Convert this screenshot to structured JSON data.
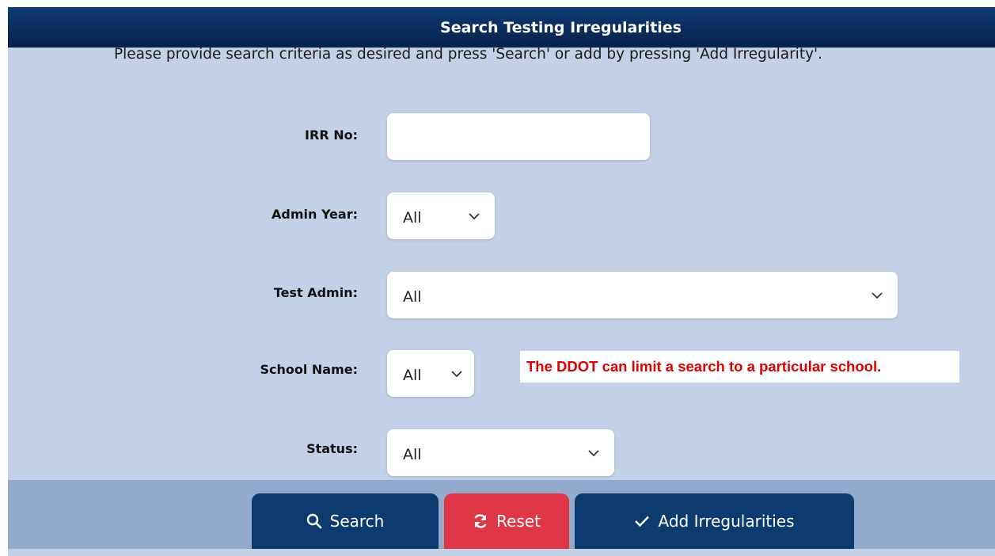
{
  "header": {
    "title": "Search Testing Irregularities"
  },
  "instructions": "Please provide search criteria as desired and press 'Search' or add by pressing 'Add Irregularity'.",
  "form": {
    "irr_no": {
      "label": "IRR No:",
      "value": ""
    },
    "admin_year": {
      "label": "Admin Year:",
      "selected": "All"
    },
    "test_admin": {
      "label": "Test Admin:",
      "selected": "All"
    },
    "school_name": {
      "label": "School Name:",
      "selected": "All"
    },
    "status": {
      "label": "Status:",
      "selected": "All"
    }
  },
  "note": "The DDOT can limit a search to a particular school.",
  "buttons": {
    "search": {
      "label": "Search",
      "icon": "search-icon"
    },
    "reset": {
      "label": "Reset",
      "icon": "refresh-icon"
    },
    "add": {
      "label": "Add Irregularities",
      "icon": "check-icon"
    }
  },
  "colors": {
    "header": "#0b2d5c",
    "panel": "#c3d0e5",
    "footer": "#93aacc",
    "button_primary": "#0c3b6f",
    "button_reset": "#df3745",
    "note_text": "#dd0000"
  }
}
